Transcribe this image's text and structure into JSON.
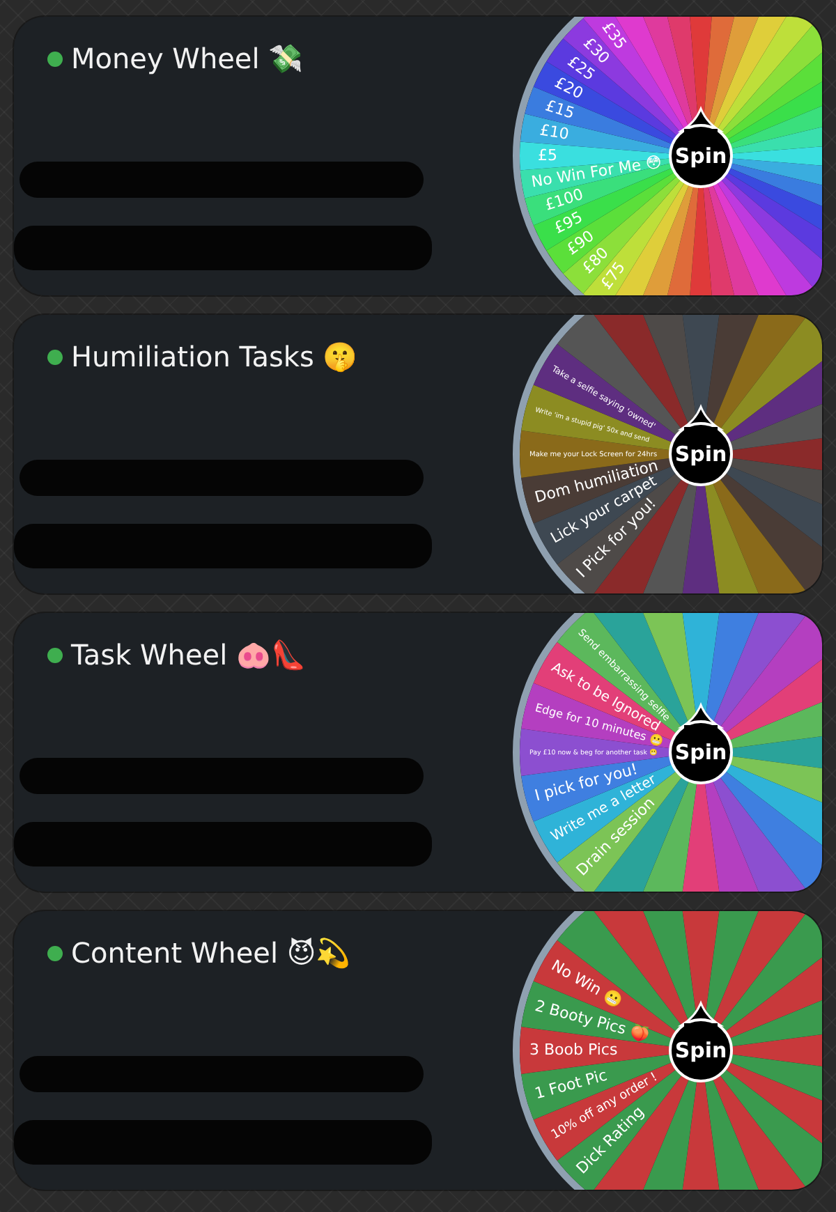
{
  "wheels": [
    {
      "title": "Money Wheel 💸",
      "spin_label": "Spin",
      "kind": "rainbow",
      "labels": [
        "£75",
        "£80",
        "£90",
        "£95",
        "£100",
        "No Win For Me 😳",
        "£5",
        "£10",
        "£15",
        "£20",
        "£25",
        "£30",
        "£35"
      ]
    },
    {
      "title": "Humiliation Tasks 🤫",
      "spin_label": "Spin",
      "kind": "dark",
      "labels": [
        "I Pick for you!",
        "Lick your carpet",
        "Dom humiliation",
        "Make me your Lock Screen for 24hrs",
        "Write 'im a stupid pig' 50x and send",
        "Take a selfie saying 'owned'"
      ]
    },
    {
      "title": "Task Wheel 🐽👠",
      "spin_label": "Spin",
      "kind": "bright",
      "labels": [
        "Drain session",
        "Write me a letter",
        "I pick for you!",
        "Pay £10 now & beg for another task 😬",
        "Edge for 10 minutes 😬",
        "Ask to be Ignored",
        "Send embarrassing selfie"
      ]
    },
    {
      "title": "Content Wheel 😈💫",
      "spin_label": "Spin",
      "kind": "redgreen",
      "labels": [
        "Dick Rating",
        "10% off any order !",
        "1 Foot Pic",
        "3 Boob Pics",
        "2 Booty Pics 🍑",
        "No Win 😬"
      ]
    }
  ]
}
